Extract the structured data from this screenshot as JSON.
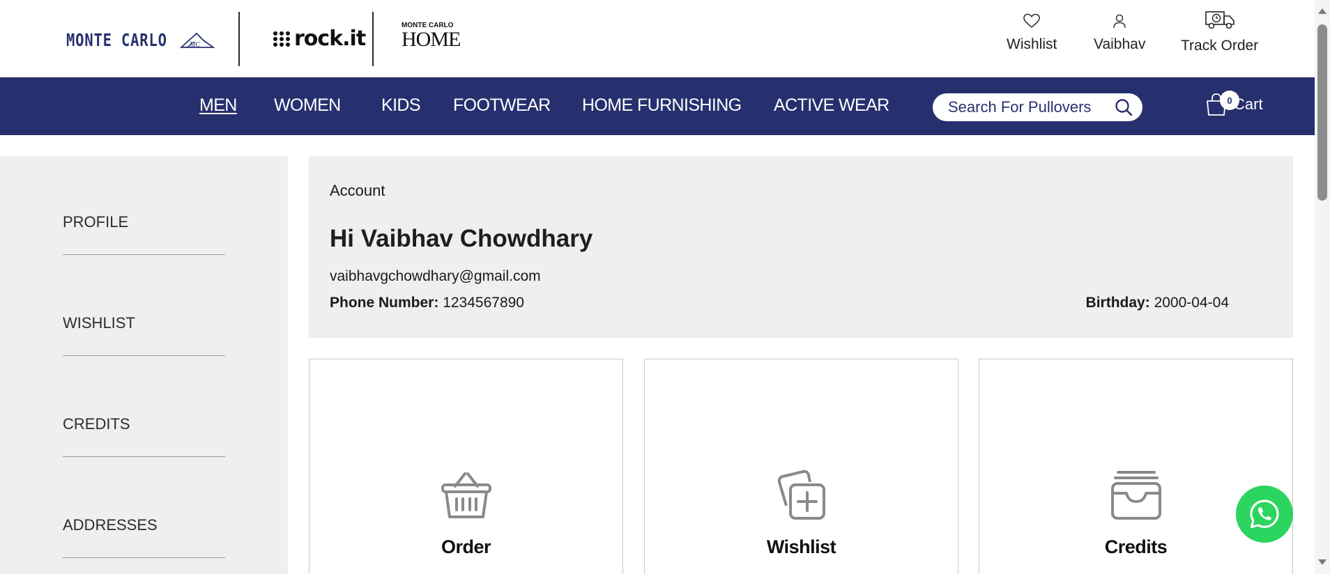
{
  "brands": {
    "monte_carlo": "MONTE CARLO",
    "monte_carlo_mark": "MC",
    "rockit": "rock.it",
    "home_small": "MONTE CARLO",
    "home_big": "HOME"
  },
  "header": {
    "wishlist_label": "Wishlist",
    "wishlist_icon": "heart-icon",
    "user_label": "Vaibhav",
    "user_icon": "user-icon",
    "track_label": "Track Order",
    "track_icon": "delivery-truck-icon"
  },
  "nav": {
    "items": [
      {
        "label": "MEN",
        "active": true
      },
      {
        "label": "WOMEN"
      },
      {
        "label": "KIDS"
      },
      {
        "label": "FOOTWEAR"
      },
      {
        "label": "HOME FURNISHING"
      },
      {
        "label": "ACTIVE WEAR"
      }
    ],
    "search_placeholder": "Search For Pullovers",
    "cart_label": "Cart",
    "cart_count": "0"
  },
  "sidebar": {
    "items": [
      {
        "label": "PROFILE"
      },
      {
        "label": "WISHLIST"
      },
      {
        "label": "CREDITS"
      },
      {
        "label": "ADDRESSES"
      }
    ]
  },
  "account": {
    "title": "Account",
    "greeting": "Hi Vaibhav Chowdhary",
    "email": "vaibhavgchowdhary@gmail.com",
    "phone_label": "Phone Number:",
    "phone_value": "1234567890",
    "birthday_label": "Birthday:",
    "birthday_value": "2000-04-04"
  },
  "tiles": [
    {
      "label": "Order",
      "icon": "basket-icon"
    },
    {
      "label": "Wishlist",
      "icon": "add-to-collection-icon"
    },
    {
      "label": "Credits",
      "icon": "wallet-tray-icon"
    }
  ],
  "colors": {
    "brand_navy": "#27306e",
    "panel_grey": "#efefef",
    "whatsapp_green": "#2bd55f"
  }
}
